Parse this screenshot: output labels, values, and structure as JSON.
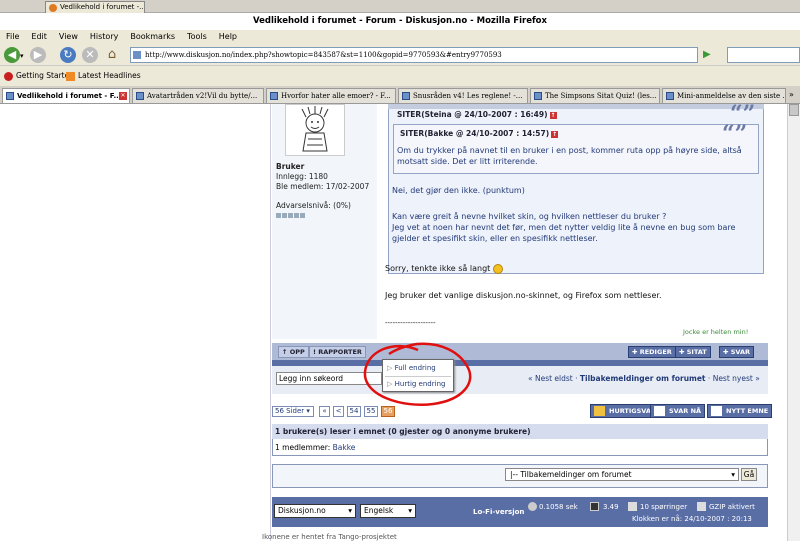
{
  "browser": {
    "top_tab": "Vedlikehold i forumet -...",
    "window_title": "Vedlikehold i forumet - Forum - Diskusjon.no - Mozilla Firefox",
    "menu": [
      "File",
      "Edit",
      "View",
      "History",
      "Bookmarks",
      "Tools",
      "Help"
    ],
    "url": "http://www.diskusjon.no/index.php?showtopic=843587&st=1100&gopid=9770593&#entry9770593",
    "bookmarks": [
      "Getting Started",
      "Latest Headlines"
    ],
    "tabs": [
      {
        "label": "Vedlikehold i forumet - F..."
      },
      {
        "label": "Avatartråden v2!Vil du bytte/..."
      },
      {
        "label": "Hvorfor hater alle emoer? - F..."
      },
      {
        "label": "Snusråden v4! Les reglene! -..."
      },
      {
        "label": "The Simpsons Sitat Quiz! (les..."
      },
      {
        "label": "Mini-anmeldelse av den siste ..."
      }
    ]
  },
  "user": {
    "name": "Bruker",
    "posts": "Innlegg: 1180",
    "member_since": "Ble medlem: 17/02-2007",
    "warning": "Advarselsnivå: (0%)"
  },
  "post": {
    "outer_quote_head": "SITER(Steina @ 24/10-2007 : 16:49)",
    "inner_quote_head": "SITER(Bakke @ 24/10-2007 : 14:57)",
    "inner_quote_text": "Om du trykker på navnet til en bruker i en post, kommer ruta opp på høyre side, altså motsatt side. Det er litt irriterende.",
    "outer_quote_p1": "Nei, det gjør den ikke. (punktum)",
    "outer_quote_p2": "Kan være greit å nevne hvilket skin, og hvilken nettleser du bruker ?",
    "outer_quote_p3": "Jeg vet at noen har nevnt det før, men det nytter veldig lite å nevne en bug som bare gjelder et spesifikt skin, eller en spesifikk nettleser.",
    "reply_p1": "Sorry, tenkte ikke så langt",
    "reply_p2": "Jeg bruker det vanlige diskusjon.no-skinnet, og Firefox som nettleser.",
    "signature_sep": "--------------------",
    "signature": "Jocke er helten min!"
  },
  "actions": {
    "up": "OPP",
    "report": "RAPPORTER",
    "edit": "REDIGER",
    "quote": "SITAT",
    "reply": "SVAR"
  },
  "popup": {
    "full_edit": "Full endring",
    "quick_edit": "Hurtig endring"
  },
  "search": {
    "placeholder": "Legg inn søkeord"
  },
  "topic_nav": {
    "prev": "« Nest eldst",
    "sep1": "·",
    "forum": "Tilbakemeldinger om forumet",
    "sep2": "·",
    "next": "Nest nyest »"
  },
  "pagination": {
    "pages_label": "56 Sider",
    "first": "«",
    "prev": "<",
    "p54": "54",
    "p55": "55",
    "p56": "56"
  },
  "post_buttons": {
    "quick_reply": "HURTIGSVAR",
    "reply_now": "SVAR NÅ",
    "new_topic": "NYTT EMNE"
  },
  "readers": {
    "head": "1 brukere(s) leser i emnet (0 gjester og 0 anonyme brukere)",
    "members_label": "1 medlemmer:",
    "member": "Bakke"
  },
  "forum_jump": {
    "selected": "|-- Tilbakemeldinger om forumet",
    "go": "Gå"
  },
  "footer": {
    "skin": "Diskusjon.no",
    "lang": "Engelsk",
    "lofi": "Lo-Fi-versjon",
    "time": "0.1058 sek",
    "load": "3.49",
    "queries": "10 spørringer",
    "gzip": "GZIP aktivert",
    "clock": "Klokken er nå: 24/10-2007 : 20:13"
  },
  "bottom_text": "Ikonene er hentet fra Tango-prosjektet"
}
